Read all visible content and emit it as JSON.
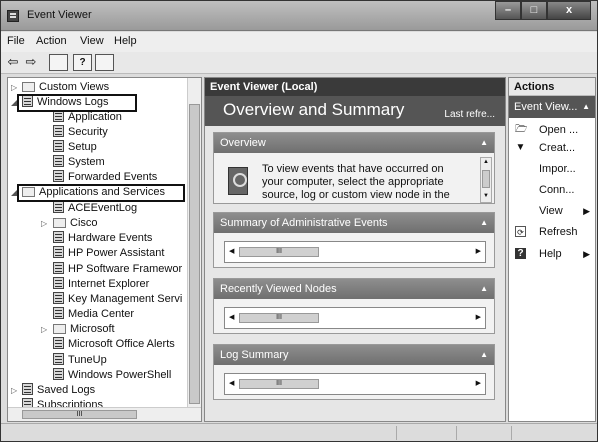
{
  "window": {
    "title": "Event Viewer",
    "minimize": "–",
    "maximize": "□",
    "close": "x"
  },
  "menu": [
    "File",
    "Action",
    "View",
    "Help"
  ],
  "toolbar": {
    "back": "⇦",
    "forward": "⇨",
    "help": "?"
  },
  "tree": {
    "items": [
      {
        "label": "Custom Views",
        "expander": "▷"
      },
      {
        "label": "Windows Logs",
        "expander": "◢"
      },
      {
        "label": "Application"
      },
      {
        "label": "Security"
      },
      {
        "label": "Setup"
      },
      {
        "label": "System"
      },
      {
        "label": "Forwarded Events"
      },
      {
        "label": "Applications and Services",
        "expander": "◢"
      },
      {
        "label": "ACEEventLog"
      },
      {
        "label": "Cisco",
        "expander": "▷"
      },
      {
        "label": "Hardware Events"
      },
      {
        "label": "HP Power Assistant"
      },
      {
        "label": "HP Software Framewor"
      },
      {
        "label": "Internet Explorer"
      },
      {
        "label": "Key Management Servi"
      },
      {
        "label": "Media Center"
      },
      {
        "label": "Microsoft",
        "expander": "▷"
      },
      {
        "label": "Microsoft Office Alerts"
      },
      {
        "label": "TuneUp"
      },
      {
        "label": "Windows PowerShell"
      },
      {
        "label": "Saved Logs",
        "expander": "▷"
      },
      {
        "label": "Subscriptions"
      }
    ]
  },
  "center": {
    "header": "Event Viewer (Local)",
    "banner_title": "Overview and Summary",
    "banner_right": "Last refre...",
    "panels": {
      "overview": {
        "title": "Overview",
        "text": "To view events that have occurred on your computer, select the appropriate source, log or custom view node in the"
      },
      "summary": {
        "title": "Summary of Administrative Events"
      },
      "recent": {
        "title": "Recently Viewed Nodes"
      },
      "logsummary": {
        "title": "Log Summary"
      }
    },
    "scroll_grip": "III"
  },
  "actions": {
    "header": "Actions",
    "section": "Event View...",
    "items": [
      {
        "label": "Open ...",
        "icon": "folder-icon"
      },
      {
        "label": "Creat...",
        "icon": "filter-icon"
      },
      {
        "label": "Impor...",
        "icon": ""
      },
      {
        "label": "Conn...",
        "icon": ""
      },
      {
        "label": "View",
        "icon": "",
        "submenu": "▶"
      },
      {
        "label": "Refresh",
        "icon": "refresh-icon"
      },
      {
        "label": "Help",
        "icon": "help-icon",
        "submenu": "▶"
      }
    ]
  }
}
